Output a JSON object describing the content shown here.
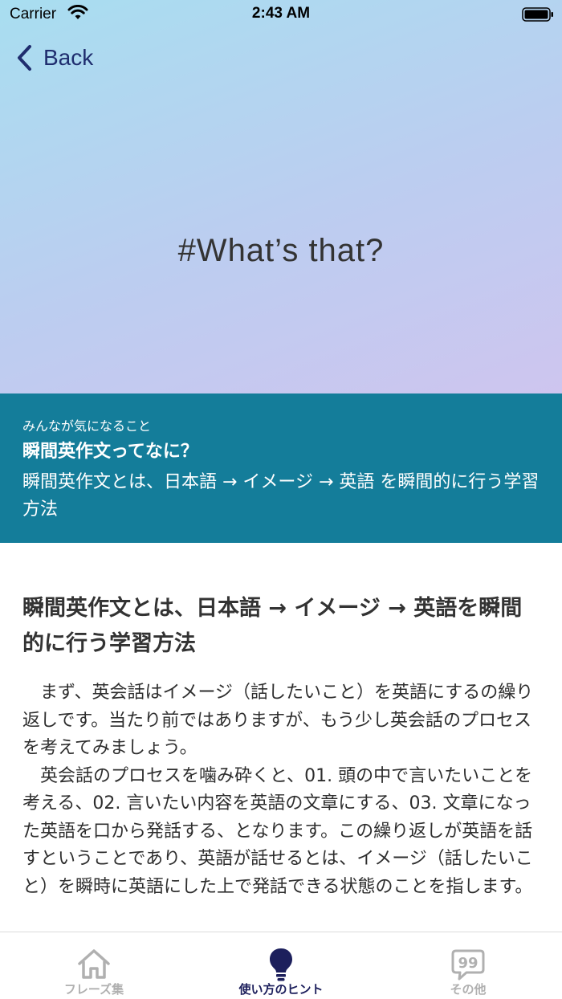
{
  "status_bar": {
    "carrier": "Carrier",
    "time": "2:43 AM"
  },
  "nav": {
    "back_label": "Back"
  },
  "hero": {
    "title": "#What’s that?"
  },
  "band": {
    "kicker": "みんなが気になること",
    "title": "瞬間英作文ってなに？",
    "description": "瞬間英作文とは、日本語 → イメージ → 英語 を瞬間的に行う学習方法"
  },
  "article": {
    "heading": "瞬間英作文とは、日本語 → イメージ → 英語を瞬間的に行う学習方法",
    "paragraphs": [
      "まず、英会話はイメージ（話したいこと）を英語にするの繰り返しです。当たり前ではありますが、もう少し英会話のプロセスを考えてみましょう。",
      "英会話のプロセスを噛み砕くと、01. 頭の中で言いたいことを考える、02. 言いたい内容を英語の文章にする、03. 文章になった英語を口から発話する、となります。この繰り返しが英語を話すということであり、英語が話せるとは、イメージ（話したいこと）を瞬時に英語にした上で発話できる状態のことを指します。"
    ]
  },
  "tab_bar": {
    "tabs": [
      {
        "label": "フレーズ集",
        "icon": "home-icon",
        "active": false
      },
      {
        "label": "使い方のヒント",
        "icon": "lightbulb-icon",
        "active": true
      },
      {
        "label": "その他",
        "icon": "quote-bubble-icon",
        "active": false
      }
    ]
  },
  "colors": {
    "band_background": "#147d9a",
    "nav_text": "#1f2d6e",
    "tab_active": "#1c1f5c",
    "tab_inactive": "#b0b0b0"
  }
}
